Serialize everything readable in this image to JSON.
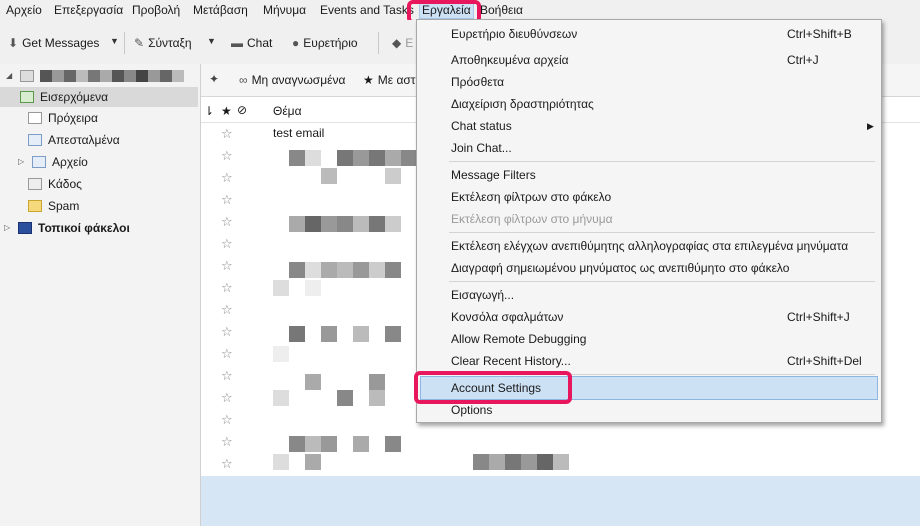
{
  "menubar": {
    "items": [
      "Αρχείο",
      "Επεξεργασία",
      "Προβολή",
      "Μετάβαση",
      "Μήνυμα",
      "Events and Tasks",
      "Εργαλεία",
      "Βοήθεια"
    ]
  },
  "toolbar": {
    "get_messages": "Get Messages",
    "compose": "Σύνταξη",
    "chat": "Chat",
    "address_book": "Ευρετήριο",
    "tag": "Ε"
  },
  "quickfilter": {
    "unread": "Μη αναγνωσμένα",
    "starred": "Με αστ"
  },
  "folders": {
    "inbox": "Εισερχόμενα",
    "drafts": "Πρόχειρα",
    "sent": "Απεσταλμένα",
    "archive": "Αρχείο",
    "trash": "Κάδος",
    "spam": "Spam",
    "local": "Τοπικοί φάκελοι"
  },
  "columns": {
    "subject": "Θέμα"
  },
  "messages": {
    "first_subject": "test email"
  },
  "tools_menu": {
    "address_book": {
      "label": "Ευρετήριο διευθύνσεων",
      "shortcut": "Ctrl+Shift+B"
    },
    "saved_files": {
      "label": "Αποθηκευμένα αρχεία",
      "shortcut": "Ctrl+J"
    },
    "addons": {
      "label": "Πρόσθετα"
    },
    "activity_manager": {
      "label": "Διαχείριση δραστηριότητας"
    },
    "chat_status": {
      "label": "Chat status"
    },
    "join_chat": {
      "label": "Join Chat..."
    },
    "message_filters": {
      "label": "Message Filters"
    },
    "run_filters_folder": {
      "label": "Εκτέλεση φίλτρων στο φάκελο"
    },
    "run_filters_message": {
      "label": "Εκτέλεση φίλτρων στο μήνυμα"
    },
    "run_junk_controls": {
      "label": "Εκτέλεση ελέγχων ανεπιθύμητης αλληλογραφίας στα επιλεγμένα μηνύματα"
    },
    "delete_junk": {
      "label": "Διαγραφή σημειωμένου μηνύματος ως ανεπιθύμητο στο φάκελο"
    },
    "import": {
      "label": "Εισαγωγή..."
    },
    "error_console": {
      "label": "Κονσόλα σφαλμάτων",
      "shortcut": "Ctrl+Shift+J"
    },
    "remote_debugging": {
      "label": "Allow Remote Debugging"
    },
    "clear_history": {
      "label": "Clear Recent History...",
      "shortcut": "Ctrl+Shift+Del"
    },
    "account_settings": {
      "label": "Account Settings"
    },
    "options": {
      "label": "Options"
    }
  },
  "colors": {
    "highlight_annotation": "#e8175d",
    "menu_hover": "#cde1f5",
    "preview_pane": "#d6e6f5"
  }
}
